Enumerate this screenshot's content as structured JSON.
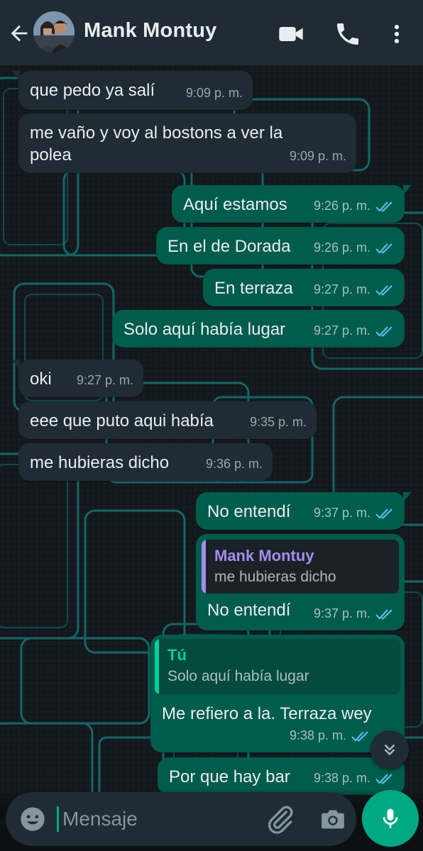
{
  "header": {
    "contact_name": "Mank Montuy"
  },
  "colors": {
    "header_bg": "#1f2c34",
    "incoming_bubble": "#202c33",
    "outgoing_bubble": "#005c4b",
    "read_ticks": "#53bdeb",
    "accent": "#00a884",
    "quote_author_incoming": "#a58cf0",
    "quote_author_outgoing": "#06cf9c"
  },
  "messages": [
    {
      "dir": "in",
      "text": "que pedo ya salí",
      "time": "9:09 p. m."
    },
    {
      "dir": "in",
      "text": "me vaño y voy al bostons a ver la polea",
      "time": "9:09 p. m."
    },
    {
      "dir": "out",
      "text": "Aquí estamos",
      "time": "9:26 p. m.",
      "status": "read"
    },
    {
      "dir": "out",
      "text": "En el de Dorada",
      "time": "9:26 p. m.",
      "status": "read"
    },
    {
      "dir": "out",
      "text": "En terraza",
      "time": "9:27 p. m.",
      "status": "read"
    },
    {
      "dir": "out",
      "text": "Solo aquí había lugar",
      "time": "9:27 p. m.",
      "status": "read"
    },
    {
      "dir": "in",
      "text": "oki",
      "time": "9:27 p. m."
    },
    {
      "dir": "in",
      "text": "eee que puto aqui había",
      "time": "9:35 p. m."
    },
    {
      "dir": "in",
      "text": "me hubieras dicho",
      "time": "9:36 p. m."
    },
    {
      "dir": "out",
      "text": "No entendí",
      "time": "9:37 p. m.",
      "status": "read"
    },
    {
      "dir": "out",
      "text": "No entendí",
      "time": "9:37 p. m.",
      "status": "read",
      "quote": {
        "author": "Mank Montuy",
        "text": "me hubieras dicho"
      }
    },
    {
      "dir": "out",
      "text": "Me refiero a la. Terraza wey",
      "time": "9:38 p. m.",
      "status": "read",
      "quote": {
        "author": "Tú",
        "text": "Solo aquí había lugar"
      }
    },
    {
      "dir": "out",
      "text": "Por que hay bar",
      "time": "9:38 p. m.",
      "status": "read"
    }
  ],
  "composer": {
    "placeholder": "Mensaje"
  },
  "icons": {
    "back": "arrow-left-icon",
    "video": "video-camera-icon",
    "call": "phone-icon",
    "menu": "more-vertical-icon",
    "emoji": "emoji-icon",
    "attach": "paperclip-icon",
    "camera": "camera-icon",
    "mic": "microphone-icon",
    "scroll": "chevron-double-down-icon"
  }
}
